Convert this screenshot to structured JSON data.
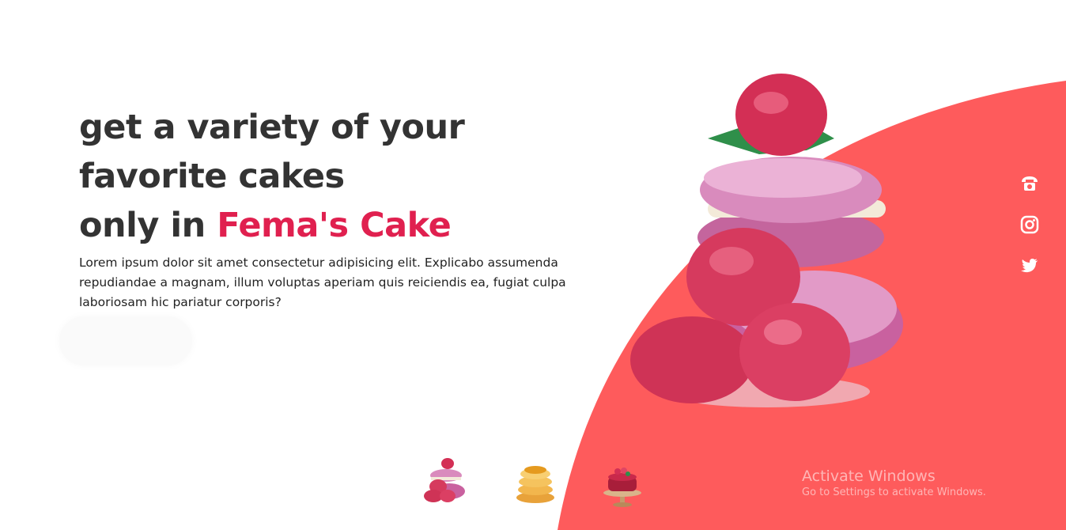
{
  "hero": {
    "headline_line1": "get a variety of your",
    "headline_line2": "favorite cakes",
    "headline_line3_prefix": "only in ",
    "brand_name": "Fema's Cake",
    "description": "Lorem ipsum dolor sit amet consectetur adipisicing elit. Explicabo assumenda repudiandae a magnam, illum voluptas aperiam quis reiciendis ea, fugiat culpa laboriosam hic pariatur corporis?"
  },
  "social": [
    "phone-icon",
    "instagram-icon",
    "twitter-icon"
  ],
  "thumbnails": [
    "macaron-raspberry-thumbnail",
    "pancake-stack-thumbnail",
    "berry-cake-stand-thumbnail"
  ],
  "watermark": {
    "title": "Activate Windows",
    "subtitle": "Go to Settings to activate Windows."
  },
  "colors": {
    "accent": "#fe5b5c",
    "brand": "#e0204f",
    "text": "#333333"
  }
}
